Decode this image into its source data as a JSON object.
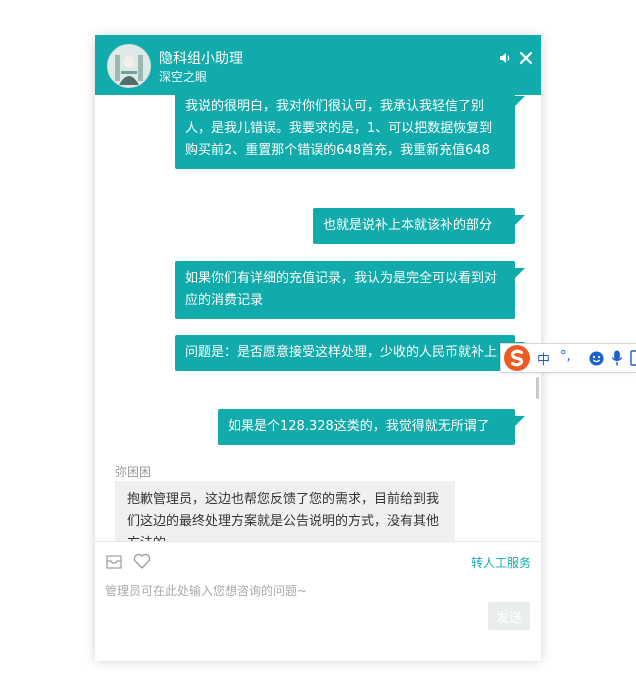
{
  "header": {
    "title": "隐科组小助理",
    "subtitle": "深空之眼",
    "speaker_icon": "speaker-icon",
    "close_icon": "close-icon"
  },
  "messages": {
    "user": [
      "我说的很明白，我对你们很认可，我承认我轻信了别人，是我儿错误。我要求的是，1、可以把数据恢复到购买前2、重置那个错误的648首充，我重新充值648",
      "也就是说补上本就该补的部分",
      "如果你们有详细的充值记录，我认为是完全可以看到对应的消费记录",
      "问题是：是否愿意接受这样处理，少收的人民币就补上",
      "如果是个128.328这类的，我觉得就无所谓了"
    ],
    "agent_name": "弥困困",
    "agent_message": "抱歉管理员，这边也帮您反馈了您的需求，目前给到我们这边的最终处理方案就是公告说明的方式，没有其他方法的"
  },
  "input": {
    "mail_icon": "mail-icon",
    "heart_icon": "heart-icon",
    "transfer_label": "转人工服务",
    "placeholder": "管理员可在此处输入您想咨询的问题~",
    "value": "",
    "send_label": "发送"
  },
  "ime_toolbar": {
    "mode": "中",
    "punct": "°,",
    "icons": [
      "sogou-logo-icon",
      "emoji-icon",
      "microphone-icon"
    ]
  },
  "colors": {
    "brand": "#12abab",
    "agent_bubble": "#eff1f1",
    "send_disabled": "#e9eded",
    "ime_blue": "#1b5fd0",
    "sogou_orange": "#f05a22"
  }
}
